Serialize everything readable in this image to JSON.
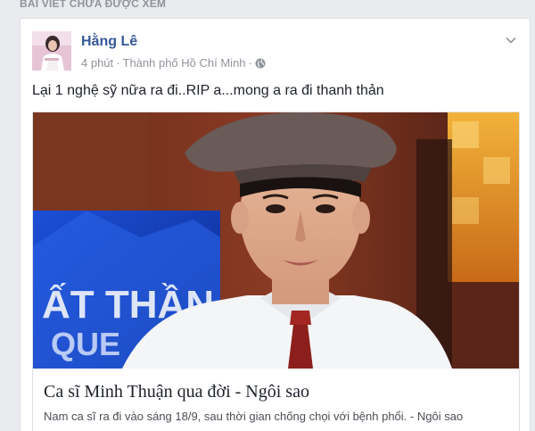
{
  "feed": {
    "section_header": "BÀI VIẾT CHƯA ĐƯỢC XEM"
  },
  "post": {
    "author": "Hằng Lê",
    "time": "4 phút",
    "separator": "·",
    "location": "Thành phố Hồ Chí Minh",
    "separator2": "·",
    "privacy_icon": "globe-icon",
    "options_icon": "chevron-down-icon",
    "text": "Lại 1 nghệ sỹ nữa ra đi..RIP a...mong a ra đi thanh thản"
  },
  "link": {
    "title": "Ca sĩ Minh Thuận qua đời - Ngôi sao",
    "description": "Nam ca sĩ ra đi vào sáng 18/9, sau thời gian chống chọi với bệnh phổi. - Ngôi sao"
  },
  "colors": {
    "background": "#e9ebee",
    "author": "#365899",
    "meta": "#90949c",
    "text": "#1d2129"
  }
}
